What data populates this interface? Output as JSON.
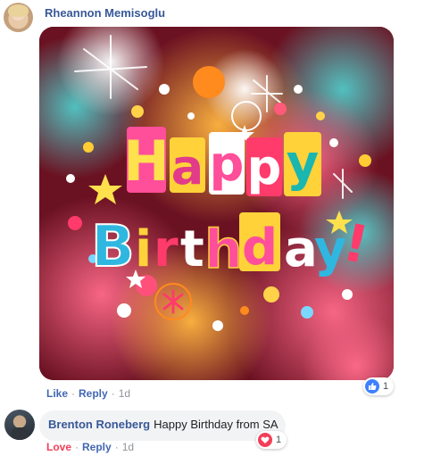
{
  "comments": [
    {
      "author": "Rheannon Memisoglu",
      "attachment_text": "Happy Birthday!",
      "actions": {
        "like": "Like",
        "reply": "Reply",
        "time": "1d"
      },
      "reaction": {
        "type": "like",
        "count": "1",
        "icon": "like-thumb-icon",
        "color": "#4080ff"
      }
    },
    {
      "author": "Brenton Roneberg",
      "text": "Happy Birthday from SA",
      "actions": {
        "like": "Love",
        "reply": "Reply",
        "time": "1d"
      },
      "reaction": {
        "type": "love",
        "count": "1",
        "icon": "heart-icon",
        "color": "#f33e58"
      }
    }
  ],
  "separator": "·",
  "colors": {
    "name_link": "#385898",
    "action_link": "#4267b2",
    "love_accent": "#f33e58",
    "muted": "#90949c"
  }
}
